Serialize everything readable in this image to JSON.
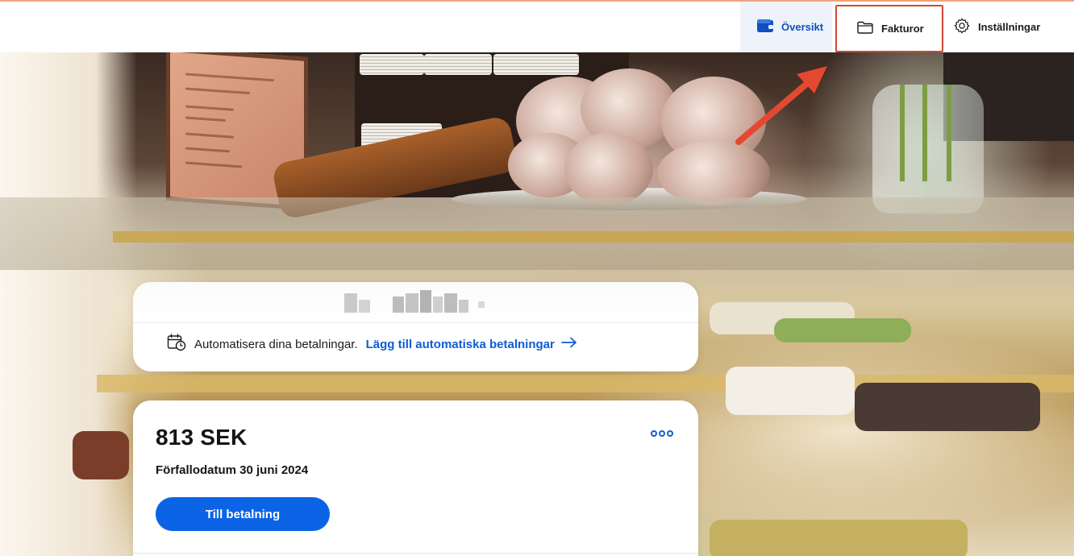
{
  "nav": {
    "overview_label": "Översikt",
    "invoices_label": "Fakturor",
    "settings_label": "Inställningar"
  },
  "autopay": {
    "text": "Automatisera dina betalningar.",
    "link_label": "Lägg till automatiska betalningar"
  },
  "invoice": {
    "amount": "813 SEK",
    "due_date": "Förfallodatum 30 juni 2024",
    "pay_button_label": "Till betalning"
  },
  "colors": {
    "accent": "#0b64e6",
    "link": "#0f5dd1",
    "highlight_box": "#cc4a33",
    "annotation_arrow": "#e4492f"
  },
  "icons": {
    "overview": "wallet-icon",
    "invoices": "folder-icon",
    "settings": "gear-icon",
    "autopay": "calendar-clock-icon",
    "link": "arrow-right-icon",
    "more": "more-dots-icon"
  }
}
